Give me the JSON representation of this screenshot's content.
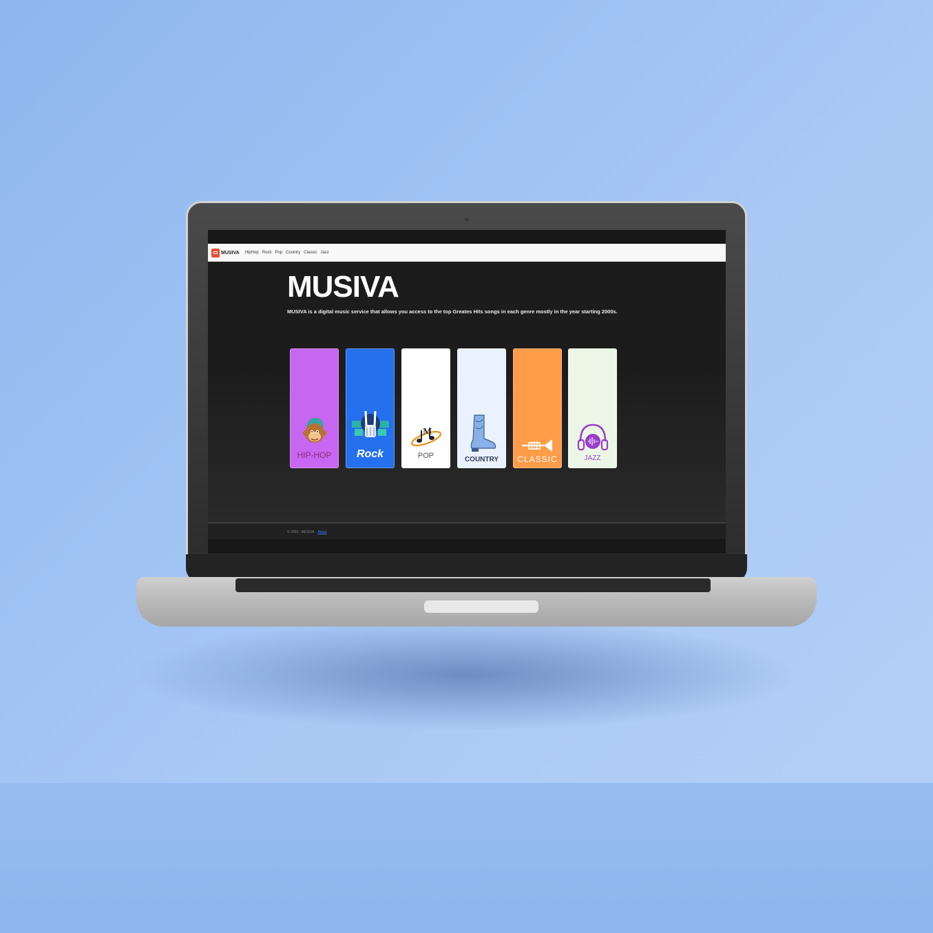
{
  "app": {
    "brand": "MUSIVA",
    "nav_links": [
      "HipHop",
      "Rock",
      "Pop",
      "Country",
      "Classic",
      "Jazz"
    ]
  },
  "hero": {
    "title": "MUSIVA",
    "description": "MUSIVA is a digital music service that allows you access to the top Greates Hits songs in each genre mostly in the year starting 2000s."
  },
  "genres": [
    {
      "label": "HIP-HOP",
      "bg": "#c766f0",
      "text_color": "#8b2c7a",
      "icon": "monkey-icon"
    },
    {
      "label": "Rock",
      "bg": "#2470ee",
      "text_color": "#ffffff",
      "icon": "skeleton-hand-icon"
    },
    {
      "label": "POP",
      "bg": "#ffffff",
      "text_color": "#555555",
      "icon": "music-note-icon"
    },
    {
      "label": "COUNTRY",
      "bg": "#eaf2ff",
      "text_color": "#2b3a58",
      "icon": "cowboy-boot-icon"
    },
    {
      "label": "CLASSIC",
      "bg": "#ff9c48",
      "text_color": "#ffffff",
      "icon": "trumpet-icon"
    },
    {
      "label": "JAZZ",
      "bg": "#ecf6e6",
      "text_color": "#9a3ec8",
      "icon": "headphones-icon"
    }
  ],
  "footer": {
    "copyright": "© 2023 · MUSIVA ·",
    "link": "About"
  }
}
